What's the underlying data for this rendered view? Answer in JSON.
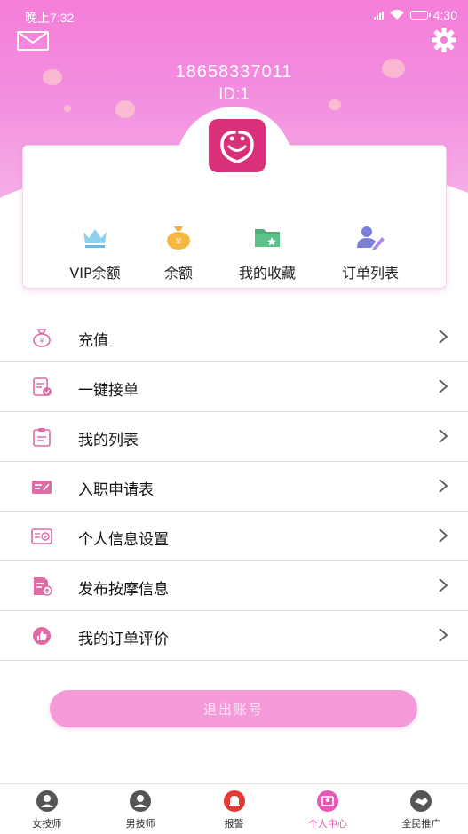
{
  "status_bar": {
    "time": "晚上7:32",
    "right_time": "4:30"
  },
  "profile": {
    "phone": "18658337011",
    "id_text": "ID:1"
  },
  "quick_actions": [
    {
      "label": "VIP余额",
      "icon": "crown-icon"
    },
    {
      "label": "余额",
      "icon": "money-bag-icon"
    },
    {
      "label": "我的收藏",
      "icon": "folder-star-icon"
    },
    {
      "label": "订单列表",
      "icon": "user-edit-icon"
    }
  ],
  "menu": [
    {
      "label": "充值",
      "icon": "money-bag-icon"
    },
    {
      "label": "一键接单",
      "icon": "document-check-icon"
    },
    {
      "label": "我的列表",
      "icon": "clipboard-icon"
    },
    {
      "label": "入职申请表",
      "icon": "id-card-icon"
    },
    {
      "label": "个人信息设置",
      "icon": "profile-card-icon"
    },
    {
      "label": "发布按摩信息",
      "icon": "document-publish-icon"
    },
    {
      "label": "我的订单评价",
      "icon": "thumbs-up-icon"
    }
  ],
  "logout_label": "退出账号",
  "tabs": [
    {
      "label": "女技师",
      "icon": "female-avatar-icon",
      "active": false
    },
    {
      "label": "男技师",
      "icon": "male-avatar-icon",
      "active": false
    },
    {
      "label": "报警",
      "icon": "alarm-bell-icon",
      "active": false
    },
    {
      "label": "个人中心",
      "icon": "personal-center-icon",
      "active": true
    },
    {
      "label": "全民推广",
      "icon": "handshake-icon",
      "active": false
    }
  ],
  "colors": {
    "header_pink": "#f47ed8",
    "accent_pink": "#e957b6",
    "logout_button": "#f49ad9",
    "logo": "#d9307a"
  }
}
